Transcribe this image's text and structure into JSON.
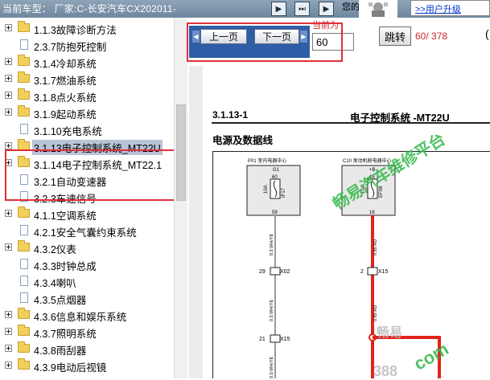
{
  "topbar": {
    "car_model": "当前车型： 厂家:C-长安汽车CX202011-",
    "nav_buttons": [
      "▶",
      "⏭",
      "▶"
    ],
    "user_text": "您的",
    "upgrade_link": ">>用户升级"
  },
  "tree": {
    "items": [
      {
        "label": "1.1.3故障诊断方法",
        "type": "folder"
      },
      {
        "label": "2.3.7防抱死控制",
        "type": "doc"
      },
      {
        "label": "3.1.4冷却系统",
        "type": "folder"
      },
      {
        "label": "3.1.7燃油系统",
        "type": "folder"
      },
      {
        "label": "3.1.8点火系统",
        "type": "folder"
      },
      {
        "label": "3.1.9起动系统",
        "type": "folder"
      },
      {
        "label": "3.1.10充电系统",
        "type": "doc"
      },
      {
        "label": "3.1.13电子控制系统_MT22U",
        "type": "folder"
      },
      {
        "label": "3.1.14电子控制系统_MT22.1",
        "type": "folder"
      },
      {
        "label": "3.2.1自动变速器",
        "type": "doc"
      },
      {
        "label": "3.2.3车速信号",
        "type": "doc"
      },
      {
        "label": "4.1.1空调系统",
        "type": "folder"
      },
      {
        "label": "4.2.1安全气囊约束系统",
        "type": "doc"
      },
      {
        "label": "4.3.2仪表",
        "type": "folder"
      },
      {
        "label": "4.3.3时钟总成",
        "type": "doc"
      },
      {
        "label": "4.3.4喇叭",
        "type": "doc"
      },
      {
        "label": "4.3.5点烟器",
        "type": "doc"
      },
      {
        "label": "4.3.6信息和娱乐系统",
        "type": "folder"
      },
      {
        "label": "4.3.7照明系统",
        "type": "folder"
      },
      {
        "label": "4.3.8雨刮器",
        "type": "folder"
      },
      {
        "label": "4.3.9电动后视镜",
        "type": "folder"
      }
    ],
    "selected_index": 7
  },
  "nav": {
    "prev_label": "上一页",
    "next_label": "下一页",
    "page_label": "当前为",
    "page_value": "60",
    "jump_label": "跳转",
    "page_count": "60/ 378",
    "paren": "("
  },
  "document": {
    "section": "3.1.13-1",
    "title": "电子控制系统 -MT22U",
    "subtitle": "电源及数据线",
    "left_box_title": "P01 室内电器中心",
    "left_box_pin": "G1",
    "left_fuse": "10A",
    "left_fuse_id": "IF17",
    "left_pin_top": "60",
    "left_pin_bottom": "59",
    "right_box_title": "C10 发动机舱电器中心",
    "right_box_pin": "+B",
    "right_fuse": "10A",
    "right_fuse_id": "EF08",
    "right_pin_top": "15",
    "right_pin_bottom": "16",
    "wire_label_1": "0.5 WH/YE",
    "wire_label_2": "0.5 WH/YE",
    "wire_label_3": "0.5 WH/YE",
    "wire_label_4": "0.85 RD",
    "wire_label_5": "0.85 RD",
    "conn_left_1_pin": "29",
    "conn_left_1": "X02",
    "conn_left_2_pin": "21",
    "conn_left_2": "X15",
    "conn_right_1_pin": "2",
    "conn_right_1": "X15",
    "watermark_main": "畅易汽车维修平台",
    "watermark_gray_1": "畅易",
    "watermark_gray_2": "388",
    "watermark_green_2": "com"
  },
  "colors": {
    "highlight_red": "#e0303a",
    "wire_red": "#e2231a",
    "watermark_green": "#33b84a",
    "nav_blue": "#2f5da6"
  }
}
